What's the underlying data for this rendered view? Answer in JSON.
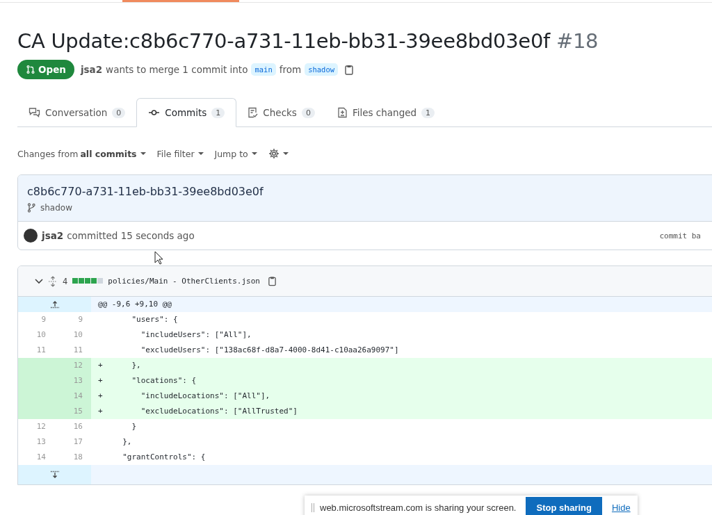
{
  "title": {
    "text": "CA Update:c8b6c770-a731-11eb-bb31-39ee8bd03e0f",
    "number": "#18"
  },
  "state": {
    "label": "Open",
    "author": "jsa2",
    "merge_text": "wants to merge 1 commit into",
    "base": "main",
    "from_text": "from",
    "head": "shadow"
  },
  "tabs": [
    {
      "label": "Conversation",
      "count": "0",
      "selected": false,
      "kind": "conversation"
    },
    {
      "label": "Commits",
      "count": "1",
      "selected": true,
      "kind": "commit"
    },
    {
      "label": "Checks",
      "count": "0",
      "selected": false,
      "kind": "checks"
    },
    {
      "label": "Files changed",
      "count": "1",
      "selected": false,
      "kind": "files"
    }
  ],
  "toolbar": {
    "changes_prefix": "Changes from",
    "changes_value": "all commits",
    "file_filter": "File filter",
    "jump_to": "Jump to"
  },
  "commit": {
    "sha": "c8b6c770-a731-11eb-bb31-39ee8bd03e0f",
    "branch": "shadow",
    "author": "jsa2",
    "time": "committed 15 seconds ago",
    "right": "commit ba"
  },
  "file": {
    "changes": "4",
    "path": "policies/Main - OtherClients.json",
    "hunk": "@@ -9,6 +9,10 @@",
    "lines": [
      {
        "kind": "context",
        "old": "9",
        "new": "9",
        "code": "    \"users\": {"
      },
      {
        "kind": "context",
        "old": "10",
        "new": "10",
        "code": "      \"includeUsers\": [\"All\"],"
      },
      {
        "kind": "context",
        "old": "11",
        "new": "11",
        "code": "      \"excludeUsers\": [\"138ac68f-d8a7-4000-8d41-c10aa26a9097\"]"
      },
      {
        "kind": "addition",
        "new": "12",
        "sign": "+",
        "code": "    },"
      },
      {
        "kind": "addition",
        "new": "13",
        "sign": "+",
        "code": "    \"locations\": {"
      },
      {
        "kind": "addition",
        "new": "14",
        "sign": "+",
        "code": "      \"includeLocations\": [\"All\"],"
      },
      {
        "kind": "addition",
        "new": "15",
        "sign": "+",
        "code": "      \"excludeLocations\": [\"AllTrusted\"]"
      },
      {
        "kind": "context",
        "old": "12",
        "new": "16",
        "code": "    }"
      },
      {
        "kind": "context",
        "old": "13",
        "new": "17",
        "code": "  },"
      },
      {
        "kind": "context",
        "old": "14",
        "new": "18",
        "code": "  \"grantControls\": {"
      }
    ]
  },
  "sharing": {
    "message": "web.microsoftstream.com is sharing your screen.",
    "stop": "Stop sharing",
    "hide": "Hide"
  }
}
